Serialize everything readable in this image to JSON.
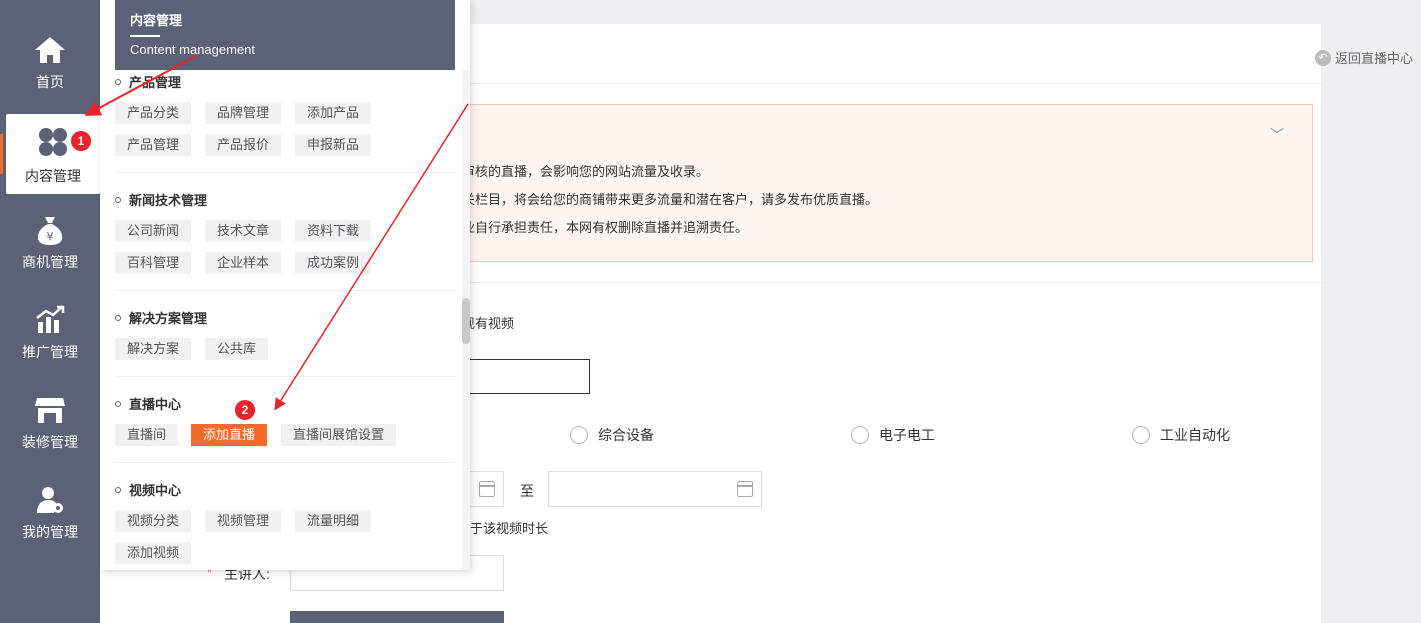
{
  "sidebar": {
    "items": [
      {
        "label": "首页",
        "icon": "home-icon"
      },
      {
        "label": "内容管理",
        "icon": "grid-icon"
      },
      {
        "label": "商机管理",
        "icon": "money-bag-icon"
      },
      {
        "label": "推广管理",
        "icon": "chart-icon"
      },
      {
        "label": "装修管理",
        "icon": "store-icon"
      },
      {
        "label": "我的管理",
        "icon": "user-gear-icon"
      }
    ]
  },
  "menu": {
    "title_cn": "内容管理",
    "title_en": "Content management",
    "sections": [
      {
        "title": "产品管理",
        "tags": [
          "产品分类",
          "品牌管理",
          "添加产品",
          "产品管理",
          "产品报价",
          "申报新品"
        ]
      },
      {
        "title": "新闻技术管理",
        "tags": [
          "公司新闻",
          "技术文章",
          "资料下载",
          "百科管理",
          "企业样本",
          "成功案例"
        ]
      },
      {
        "title": "解决方案管理",
        "tags": [
          "解决方案",
          "公共库"
        ]
      },
      {
        "title": "直播中心",
        "tags": [
          "直播间",
          "添加直播",
          "直播间展馆设置"
        ]
      },
      {
        "title": "视频中心",
        "tags": [
          "视频分类",
          "视频管理",
          "流量明细",
          "添加视频"
        ]
      }
    ]
  },
  "main": {
    "back_link": "返回直播中心",
    "notice_lines": [
      "随意删除已通过审核的直播，会影响您的网站流量及收录。",
      "送至行业网站相关栏目，将会给您的商铺带来更多流量和潜在客户，请多发布优质直播。",
      "，一律由发布企业自行承担责任，本网有权删除直播并追溯责任。"
    ],
    "video_option_fragment": "现有视频",
    "radio_options": [
      "综合设备",
      "电子电工",
      "工业自动化"
    ],
    "date_separator": "至",
    "duration_hint_fragment": "于该视频时长",
    "speaker_label": "主讲人:",
    "required_mark": "*"
  },
  "annotations": {
    "badge1": "1",
    "badge2": "2",
    "color": "#e8232a"
  },
  "colors": {
    "sidebar": "#5d6178",
    "accent": "#f36b2b"
  }
}
